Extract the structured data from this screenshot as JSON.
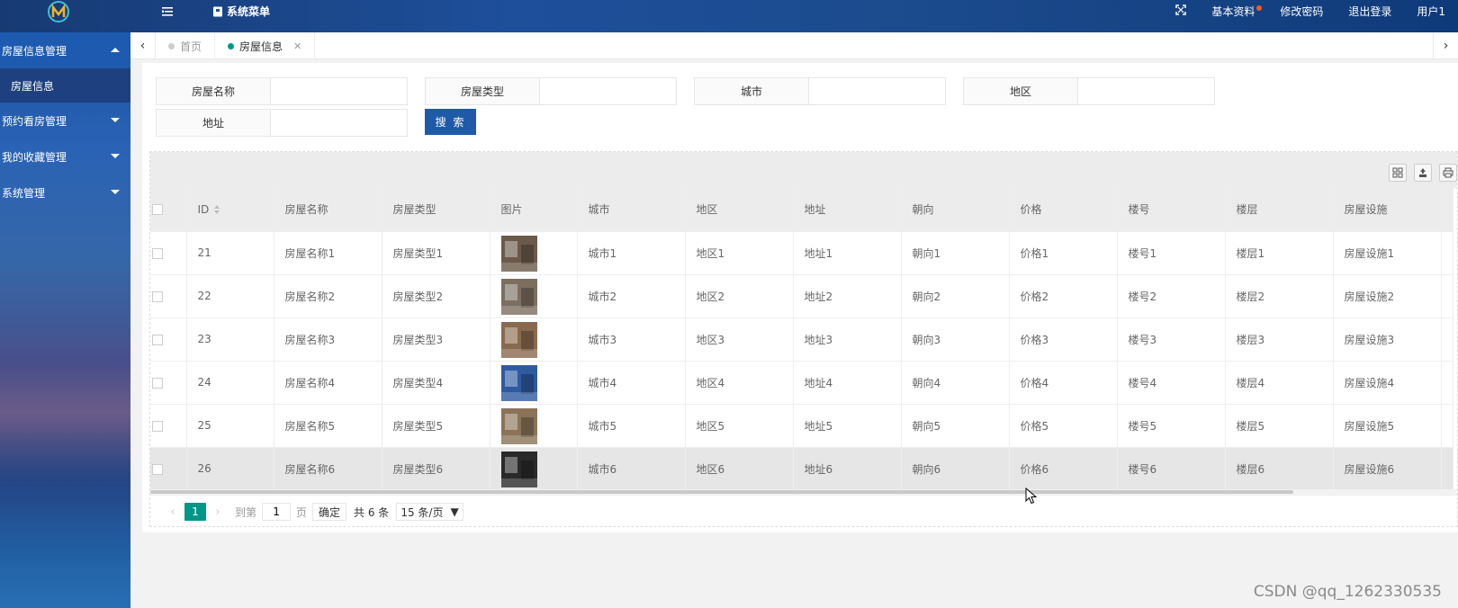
{
  "header": {
    "system_menu": "系统菜单",
    "links": [
      "基本资料",
      "修改密码",
      "退出登录",
      "用户1"
    ]
  },
  "sidebar": {
    "groups": [
      {
        "label": "房屋信息管理",
        "open": true,
        "children": [
          "房屋信息"
        ]
      },
      {
        "label": "预约看房管理",
        "open": false
      },
      {
        "label": "我的收藏管理",
        "open": false
      },
      {
        "label": "系统管理",
        "open": false
      }
    ]
  },
  "tabs": [
    {
      "label": "首页",
      "active": false
    },
    {
      "label": "房屋信息",
      "active": true
    }
  ],
  "search": {
    "fields": [
      "房屋名称",
      "房屋类型",
      "城市",
      "地区",
      "地址"
    ],
    "button": "搜 索"
  },
  "table": {
    "columns": [
      "ID",
      "房屋名称",
      "房屋类型",
      "图片",
      "城市",
      "地区",
      "地址",
      "朝向",
      "价格",
      "楼号",
      "楼层",
      "房屋设施"
    ],
    "rows": [
      [
        "21",
        "房屋名称1",
        "房屋类型1",
        "",
        "城市1",
        "地区1",
        "地址1",
        "朝向1",
        "价格1",
        "楼号1",
        "楼层1",
        "房屋设施1"
      ],
      [
        "22",
        "房屋名称2",
        "房屋类型2",
        "",
        "城市2",
        "地区2",
        "地址2",
        "朝向2",
        "价格2",
        "楼号2",
        "楼层2",
        "房屋设施2"
      ],
      [
        "23",
        "房屋名称3",
        "房屋类型3",
        "",
        "城市3",
        "地区3",
        "地址3",
        "朝向3",
        "价格3",
        "楼号3",
        "楼层3",
        "房屋设施3"
      ],
      [
        "24",
        "房屋名称4",
        "房屋类型4",
        "",
        "城市4",
        "地区4",
        "地址4",
        "朝向4",
        "价格4",
        "楼号4",
        "楼层4",
        "房屋设施4"
      ],
      [
        "25",
        "房屋名称5",
        "房屋类型5",
        "",
        "城市5",
        "地区5",
        "地址5",
        "朝向5",
        "价格5",
        "楼号5",
        "楼层5",
        "房屋设施5"
      ],
      [
        "26",
        "房屋名称6",
        "房屋类型6",
        "",
        "城市6",
        "地区6",
        "地址6",
        "朝向6",
        "价格6",
        "楼号6",
        "楼层6",
        "房屋设施6"
      ]
    ],
    "thumb_colors": [
      "#6b5a4a",
      "#7c6e60",
      "#8a6a4e",
      "#2e5aa0",
      "#8a7358",
      "#2a2a2a"
    ]
  },
  "pager": {
    "current": "1",
    "goto_label": "到第",
    "page_input": "1",
    "page_unit": "页",
    "confirm": "确定",
    "total": "共 6 条",
    "page_size": "15 条/页"
  },
  "watermark": "CSDN @qq_1262330535",
  "colors": {
    "accent": "#009688",
    "primary": "#1e5aa8"
  }
}
